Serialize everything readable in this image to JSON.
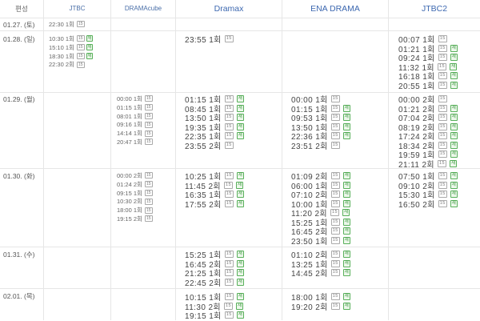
{
  "headers": {
    "date": "편성",
    "jtbc": "JTBC",
    "dramacube": "DRAMAcube",
    "dramax": "Dramax",
    "ena": "ENA DRAMA",
    "jtbc2": "JTBC2"
  },
  "dates": [
    "01.27. (토)",
    "01.28. (일)",
    "01.29. (월)",
    "01.30. (화)",
    "01.31. (수)",
    "02.01. (목)"
  ],
  "colors": {
    "header_text": "#3d68b0",
    "rerun_badge": "#3d9a40",
    "divider": "#e6e6e6"
  },
  "rating_label": "15",
  "rerun_label": "재",
  "schedule": {
    "jtbc": [
      [
        {
          "t": "22:30 1회",
          "r": false
        }
      ],
      [
        {
          "t": "10:30 1회",
          "r": true
        },
        {
          "t": "15:10 1회",
          "r": true
        },
        {
          "t": "18:30 1회",
          "r": true
        },
        {
          "t": "22:30 2회",
          "r": false
        }
      ],
      [],
      [],
      [],
      []
    ],
    "dramacube": [
      [],
      [],
      [
        {
          "t": "00:00 1회",
          "r": false
        },
        {
          "t": "01:15 1회",
          "r": false
        },
        {
          "t": "08:01 1회",
          "r": false
        },
        {
          "t": "09:16 1회",
          "r": false
        },
        {
          "t": "14:14 1회",
          "r": false
        },
        {
          "t": "20:47 1회",
          "r": false
        }
      ],
      [
        {
          "t": "00:00 2회",
          "r": false
        },
        {
          "t": "01:24 2회",
          "r": false
        },
        {
          "t": "09:15 1회",
          "r": false
        },
        {
          "t": "10:30 2회",
          "r": false
        },
        {
          "t": "18:00 1회",
          "r": false
        },
        {
          "t": "19:15 2회",
          "r": false
        }
      ],
      [],
      []
    ],
    "dramax": [
      [],
      [
        {
          "t": "23:55 1회",
          "r": false
        }
      ],
      [
        {
          "t": "01:15 1회",
          "r": true
        },
        {
          "t": "08:45 1회",
          "r": true
        },
        {
          "t": "13:50 1회",
          "r": true
        },
        {
          "t": "19:35 1회",
          "r": true
        },
        {
          "t": "22:35 1회",
          "r": true
        },
        {
          "t": "23:55 2회",
          "r": false
        }
      ],
      [
        {
          "t": "10:25 1회",
          "r": true
        },
        {
          "t": "11:45 2회",
          "r": true
        },
        {
          "t": "16:35 1회",
          "r": true
        },
        {
          "t": "17:55 2회",
          "r": true
        }
      ],
      [
        {
          "t": "15:25 1회",
          "r": true
        },
        {
          "t": "16:45 2회",
          "r": true
        },
        {
          "t": "21:25 1회",
          "r": true
        },
        {
          "t": "22:45 2회",
          "r": true
        }
      ],
      [
        {
          "t": "10:15 1회",
          "r": true
        },
        {
          "t": "11:30 2회",
          "r": true
        },
        {
          "t": "19:15 1회",
          "r": true
        }
      ]
    ],
    "ena": [
      [],
      [],
      [
        {
          "t": "00:00 1회",
          "r": false
        },
        {
          "t": "01:15 1회",
          "r": true
        },
        {
          "t": "09:53 1회",
          "r": true
        },
        {
          "t": "13:50 1회",
          "r": true
        },
        {
          "t": "22:36 1회",
          "r": true
        },
        {
          "t": "23:51 2회",
          "r": false
        }
      ],
      [
        {
          "t": "01:09 2회",
          "r": true
        },
        {
          "t": "06:00 1회",
          "r": true
        },
        {
          "t": "07:10 2회",
          "r": true
        },
        {
          "t": "10:00 1회",
          "r": true
        },
        {
          "t": "11:20 2회",
          "r": true
        },
        {
          "t": "15:25 1회",
          "r": true
        },
        {
          "t": "16:45 2회",
          "r": true
        },
        {
          "t": "23:50 1회",
          "r": true
        }
      ],
      [
        {
          "t": "01:10 2회",
          "r": true
        },
        {
          "t": "13:25 1회",
          "r": true
        },
        {
          "t": "14:45 2회",
          "r": true
        }
      ],
      [
        {
          "t": "18:00 1회",
          "r": true
        },
        {
          "t": "19:20 2회",
          "r": true
        }
      ]
    ],
    "jtbc2": [
      [],
      [
        {
          "t": "00:07 1회",
          "r": false
        },
        {
          "t": "01:21 1회",
          "r": true
        },
        {
          "t": "09:24 1회",
          "r": true
        },
        {
          "t": "11:32 1회",
          "r": true
        },
        {
          "t": "16:18 1회",
          "r": true
        },
        {
          "t": "20:55 1회",
          "r": true
        }
      ],
      [
        {
          "t": "00:00 2회",
          "r": false
        },
        {
          "t": "01:21 2회",
          "r": true
        },
        {
          "t": "07:04 2회",
          "r": true
        },
        {
          "t": "08:19 2회",
          "r": true
        },
        {
          "t": "17:24 2회",
          "r": true
        },
        {
          "t": "18:34 2회",
          "r": true
        },
        {
          "t": "19:59 1회",
          "r": true
        },
        {
          "t": "21:11 2회",
          "r": true
        }
      ],
      [
        {
          "t": "07:50 1회",
          "r": true
        },
        {
          "t": "09:10 2회",
          "r": true
        },
        {
          "t": "15:30 1회",
          "r": true
        },
        {
          "t": "16:50 2회",
          "r": true
        }
      ],
      [],
      []
    ]
  }
}
